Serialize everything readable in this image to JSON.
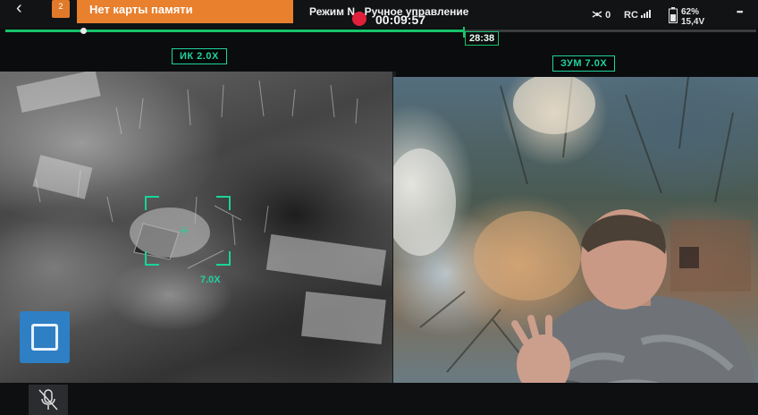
{
  "topbar": {
    "back_icon": "chevron-left-icon",
    "back_glyph": "‹",
    "badge_text": "2",
    "warning_text": "Нет карты памяти",
    "mode_text": "Режим N - Ручное управление",
    "record_time": "00:09:57",
    "status": {
      "signal_icon": "drone-signal-icon",
      "signal_value": "0",
      "rc_label": "RC",
      "battery_percent": "62%",
      "battery_voltage": "15,4V",
      "more_icon": "more-dots-icon",
      "more_glyph": "•••"
    }
  },
  "timeline": {
    "time_label": "28:38",
    "progress": 0.61,
    "accent_color": "#17c36a"
  },
  "cameras": {
    "ir": {
      "label": "ИК 2.0X",
      "zoom_value": "7.0X"
    },
    "zoom": {
      "label": "ЗУМ 7.0X"
    }
  },
  "controls": {
    "camera_button_icon": "camera-switch-icon",
    "mic_icon": "mic-muted-icon"
  },
  "colors": {
    "hud_green": "#1fd3a0",
    "warning_orange": "#e8802e",
    "record_red": "#e0203a",
    "button_blue": "#2f7fc4"
  }
}
